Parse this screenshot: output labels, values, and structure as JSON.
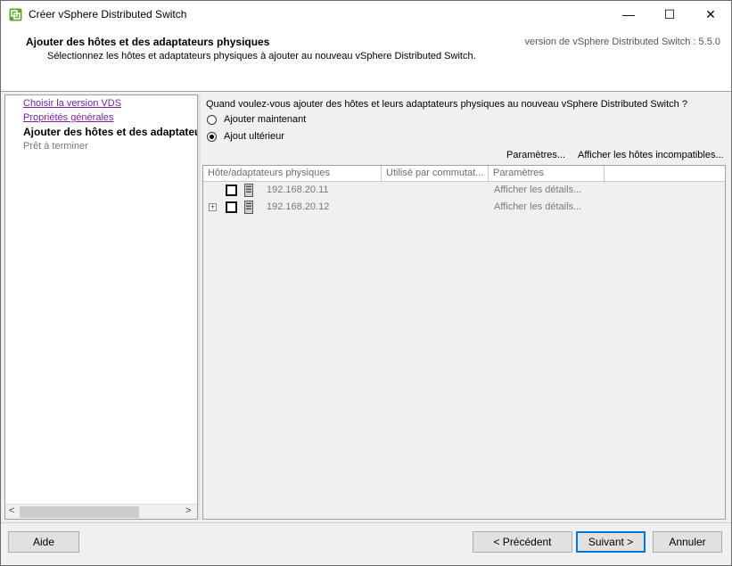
{
  "window": {
    "title": "Créer vSphere Distributed Switch",
    "controls": {
      "minimize": "—",
      "maximize": "☐",
      "close": "✕"
    }
  },
  "header": {
    "title": "Ajouter des hôtes et des adaptateurs physiques",
    "subtitle": "Sélectionnez les hôtes et adaptateurs physiques à ajouter au nouveau vSphere Distributed Switch.",
    "version": "version de vSphere Distributed Switch : 5.5.0"
  },
  "nav": {
    "items": [
      {
        "label": "Choisir la version VDS",
        "state": "link"
      },
      {
        "label": "Propriétés générales",
        "state": "link"
      },
      {
        "label": "Ajouter des hôtes et des adaptateurs physiques",
        "state": "current"
      },
      {
        "label": "Prêt à terminer",
        "state": "disabled"
      }
    ],
    "scroll_left": "<",
    "scroll_right": ">"
  },
  "main": {
    "question": "Quand voulez-vous ajouter des hôtes et leurs adaptateurs physiques au nouveau vSphere Distributed Switch ?",
    "options": [
      {
        "label": "Ajouter maintenant",
        "checked": false
      },
      {
        "label": "Ajout ultérieur",
        "checked": true
      }
    ],
    "links": {
      "parameters": "Paramètres...",
      "incompatible": "Afficher les hôtes incompatibles..."
    },
    "table": {
      "columns": [
        "Hôte/adaptateurs physiques",
        "Utilisé par commutat...",
        "Paramètres"
      ],
      "rows": [
        {
          "host": "192.168.20.11",
          "used_by": "",
          "settings": "Afficher les détails...",
          "expandable": false
        },
        {
          "host": "192.168.20.12",
          "used_by": "",
          "settings": "Afficher les détails...",
          "expandable": true,
          "expander": "+"
        }
      ]
    }
  },
  "footer": {
    "help": "Aide",
    "previous": "< Précédent",
    "next": "Suivant >",
    "cancel": "Annuler"
  },
  "colors": {
    "link": "#7a1fa0",
    "default_button_border": "#0078d7",
    "icon_green": "#6aa12a"
  },
  "icons": {
    "app": "vsphere-logo-icon",
    "host": "server-icon"
  }
}
